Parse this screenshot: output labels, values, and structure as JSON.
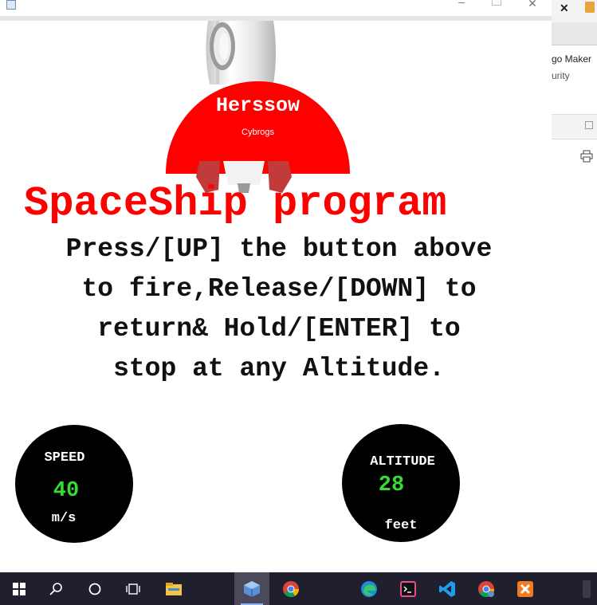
{
  "background_app": {
    "close_glyph": "✕",
    "text_1": "go Maker",
    "text_2": "urity",
    "print_icon": "print-icon"
  },
  "window": {
    "app_icon": "java-icon",
    "minimize_glyph": "–",
    "close_glyph": "✕"
  },
  "brand": {
    "title": "Herssow",
    "subtitle": "Cybrogs",
    "color": "#ff0000"
  },
  "heading": "SpaceShip program",
  "instructions": [
    "Press/[UP] the button above",
    "to fire,Release/[DOWN] to",
    "return& Hold/[ENTER] to",
    "stop at any Altitude."
  ],
  "speed": {
    "label": "SPEED",
    "value": "40",
    "unit": "m/s"
  },
  "altitude": {
    "label": "ALTITUDE",
    "value": "28",
    "unit": "feet"
  },
  "colors": {
    "accent": "#ff0000",
    "value_green": "#33dd33",
    "gauge_bg": "#000000"
  },
  "taskbar": {
    "items": [
      "windows-start-icon",
      "search-icon",
      "cortana-icon",
      "task-view-icon",
      "file-explorer-icon",
      "virtualbox-icon",
      "chrome-icon",
      "edge-icon",
      "terminal-icon",
      "vscode-icon",
      "chrome-profile-icon",
      "xampp-icon"
    ]
  }
}
